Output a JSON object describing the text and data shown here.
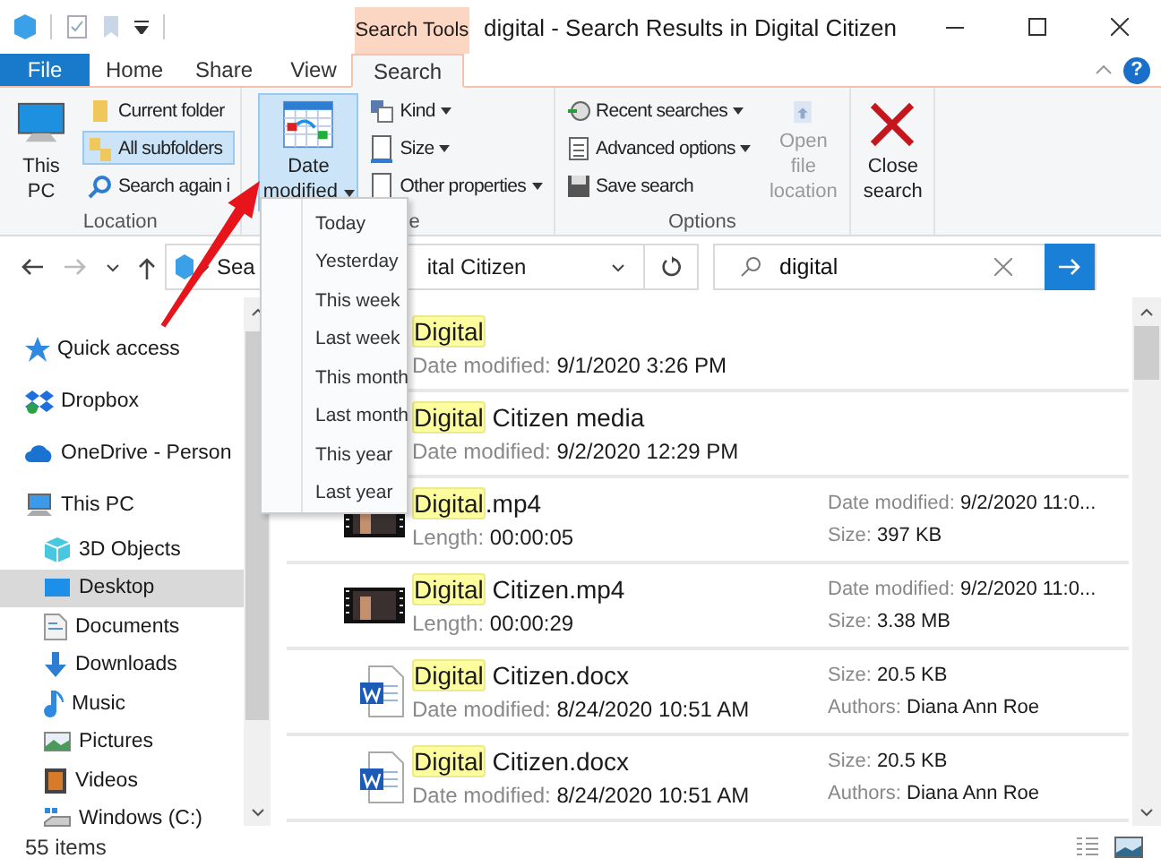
{
  "window": {
    "title": "digital - Search Results in Digital Citizen",
    "context_tab": "Search Tools"
  },
  "tabs": [
    {
      "label": "File",
      "kind": "file",
      "selected": false
    },
    {
      "label": "Home",
      "kind": "tab",
      "selected": false
    },
    {
      "label": "Share",
      "kind": "tab",
      "selected": false
    },
    {
      "label": "View",
      "kind": "tab",
      "selected": false
    },
    {
      "label": "Search",
      "kind": "tab",
      "selected": true
    }
  ],
  "help": "?",
  "ribbon": {
    "groups": [
      {
        "label": "Location",
        "sections": [
          {
            "kind": "big",
            "items": [
              {
                "label": "This PC",
                "selected": false,
                "disabled": false,
                "menu": false
              }
            ]
          },
          {
            "kind": "stack",
            "items": [
              {
                "label": "Current folder",
                "selected": false,
                "menu": false
              },
              {
                "label": "All subfolders",
                "selected": true,
                "menu": false
              },
              {
                "label": "Search again i",
                "selected": false,
                "menu": false
              }
            ]
          }
        ]
      },
      {
        "label": "e",
        "sections": [
          {
            "kind": "big",
            "items": [
              {
                "label": "Date modified",
                "selected": true,
                "disabled": false,
                "menu": true
              }
            ]
          },
          {
            "kind": "stack",
            "items": [
              {
                "label": "Kind",
                "selected": false,
                "menu": true
              },
              {
                "label": "Size",
                "selected": false,
                "menu": true
              },
              {
                "label": "Other properties",
                "selected": false,
                "menu": true
              }
            ]
          }
        ]
      },
      {
        "label": "Options",
        "sections": [
          {
            "kind": "stack",
            "items": [
              {
                "label": "Recent searches",
                "selected": false,
                "menu": true
              },
              {
                "label": "Advanced options",
                "selected": false,
                "menu": true
              },
              {
                "label": "Save search",
                "selected": false,
                "menu": false
              }
            ]
          },
          {
            "kind": "big",
            "items": [
              {
                "label": "Open file location",
                "selected": false,
                "disabled": true,
                "menu": false
              }
            ]
          }
        ]
      },
      {
        "sections": [
          {
            "kind": "big",
            "items": [
              {
                "label": "Close search",
                "selected": false,
                "disabled": false,
                "menu": false
              }
            ]
          }
        ]
      }
    ]
  },
  "date_menu": {
    "items": [
      "Today",
      "Yesterday",
      "This week",
      "Last week",
      "This month",
      "Last month",
      "This year",
      "Last year"
    ]
  },
  "address": {
    "text_start": "Sea",
    "text_end": "ital Citizen"
  },
  "search": {
    "value": "digital"
  },
  "sidebar": {
    "items": [
      {
        "label": "Quick access",
        "selected": false
      },
      {
        "label": "Dropbox",
        "selected": false
      },
      {
        "label": "OneDrive - Person",
        "selected": false
      },
      {
        "label": "This PC",
        "selected": false,
        "children": [
          {
            "label": "3D Objects",
            "selected": false
          },
          {
            "label": "Desktop",
            "selected": true
          },
          {
            "label": "Documents",
            "selected": false
          },
          {
            "label": "Downloads",
            "selected": false
          },
          {
            "label": "Music",
            "selected": false
          },
          {
            "label": "Pictures",
            "selected": false
          },
          {
            "label": "Videos",
            "selected": false
          },
          {
            "label": "Windows (C:)",
            "selected": false
          }
        ]
      }
    ]
  },
  "results": [
    {
      "match": "Digital",
      "details": [
        {
          "label": "Date modified:",
          "value": "9/1/2020 3:26 PM"
        }
      ]
    },
    {
      "match": "Digital",
      "rest": " Citizen media",
      "details": [
        {
          "label": "Date modified:",
          "value": "9/2/2020 12:29 PM"
        }
      ]
    },
    {
      "kind": "video",
      "match": "Digital",
      "rest": ".mp4",
      "details": [
        {
          "label": "Length:",
          "value": "00:00:05"
        }
      ],
      "side": [
        {
          "label": "Date modified:",
          "value": "9/2/2020 11:0..."
        },
        {
          "label": "Size:",
          "value": "397 KB"
        }
      ]
    },
    {
      "kind": "video",
      "match": "Digital",
      "rest": " Citizen.mp4",
      "details": [
        {
          "label": "Length:",
          "value": "00:00:29"
        }
      ],
      "side": [
        {
          "label": "Date modified:",
          "value": "9/2/2020 11:0..."
        },
        {
          "label": "Size:",
          "value": "3.38 MB"
        }
      ]
    },
    {
      "kind": "document",
      "match": "Digital",
      "rest": " Citizen.docx",
      "details": [
        {
          "label": "Date modified:",
          "value": "8/24/2020 10:51 AM"
        }
      ],
      "side": [
        {
          "label": "Size:",
          "value": "20.5 KB"
        },
        {
          "label": "Authors:",
          "value": "Diana Ann Roe"
        }
      ]
    },
    {
      "kind": "document",
      "match": "Digital",
      "rest": " Citizen.docx",
      "details": [
        {
          "label": "Date modified:",
          "value": "8/24/2020 10:51 AM"
        }
      ],
      "side": [
        {
          "label": "Size:",
          "value": "20.5 KB"
        },
        {
          "label": "Authors:",
          "value": "Diana Ann Roe"
        }
      ]
    }
  ],
  "status_bar": {
    "count": "55 items"
  }
}
